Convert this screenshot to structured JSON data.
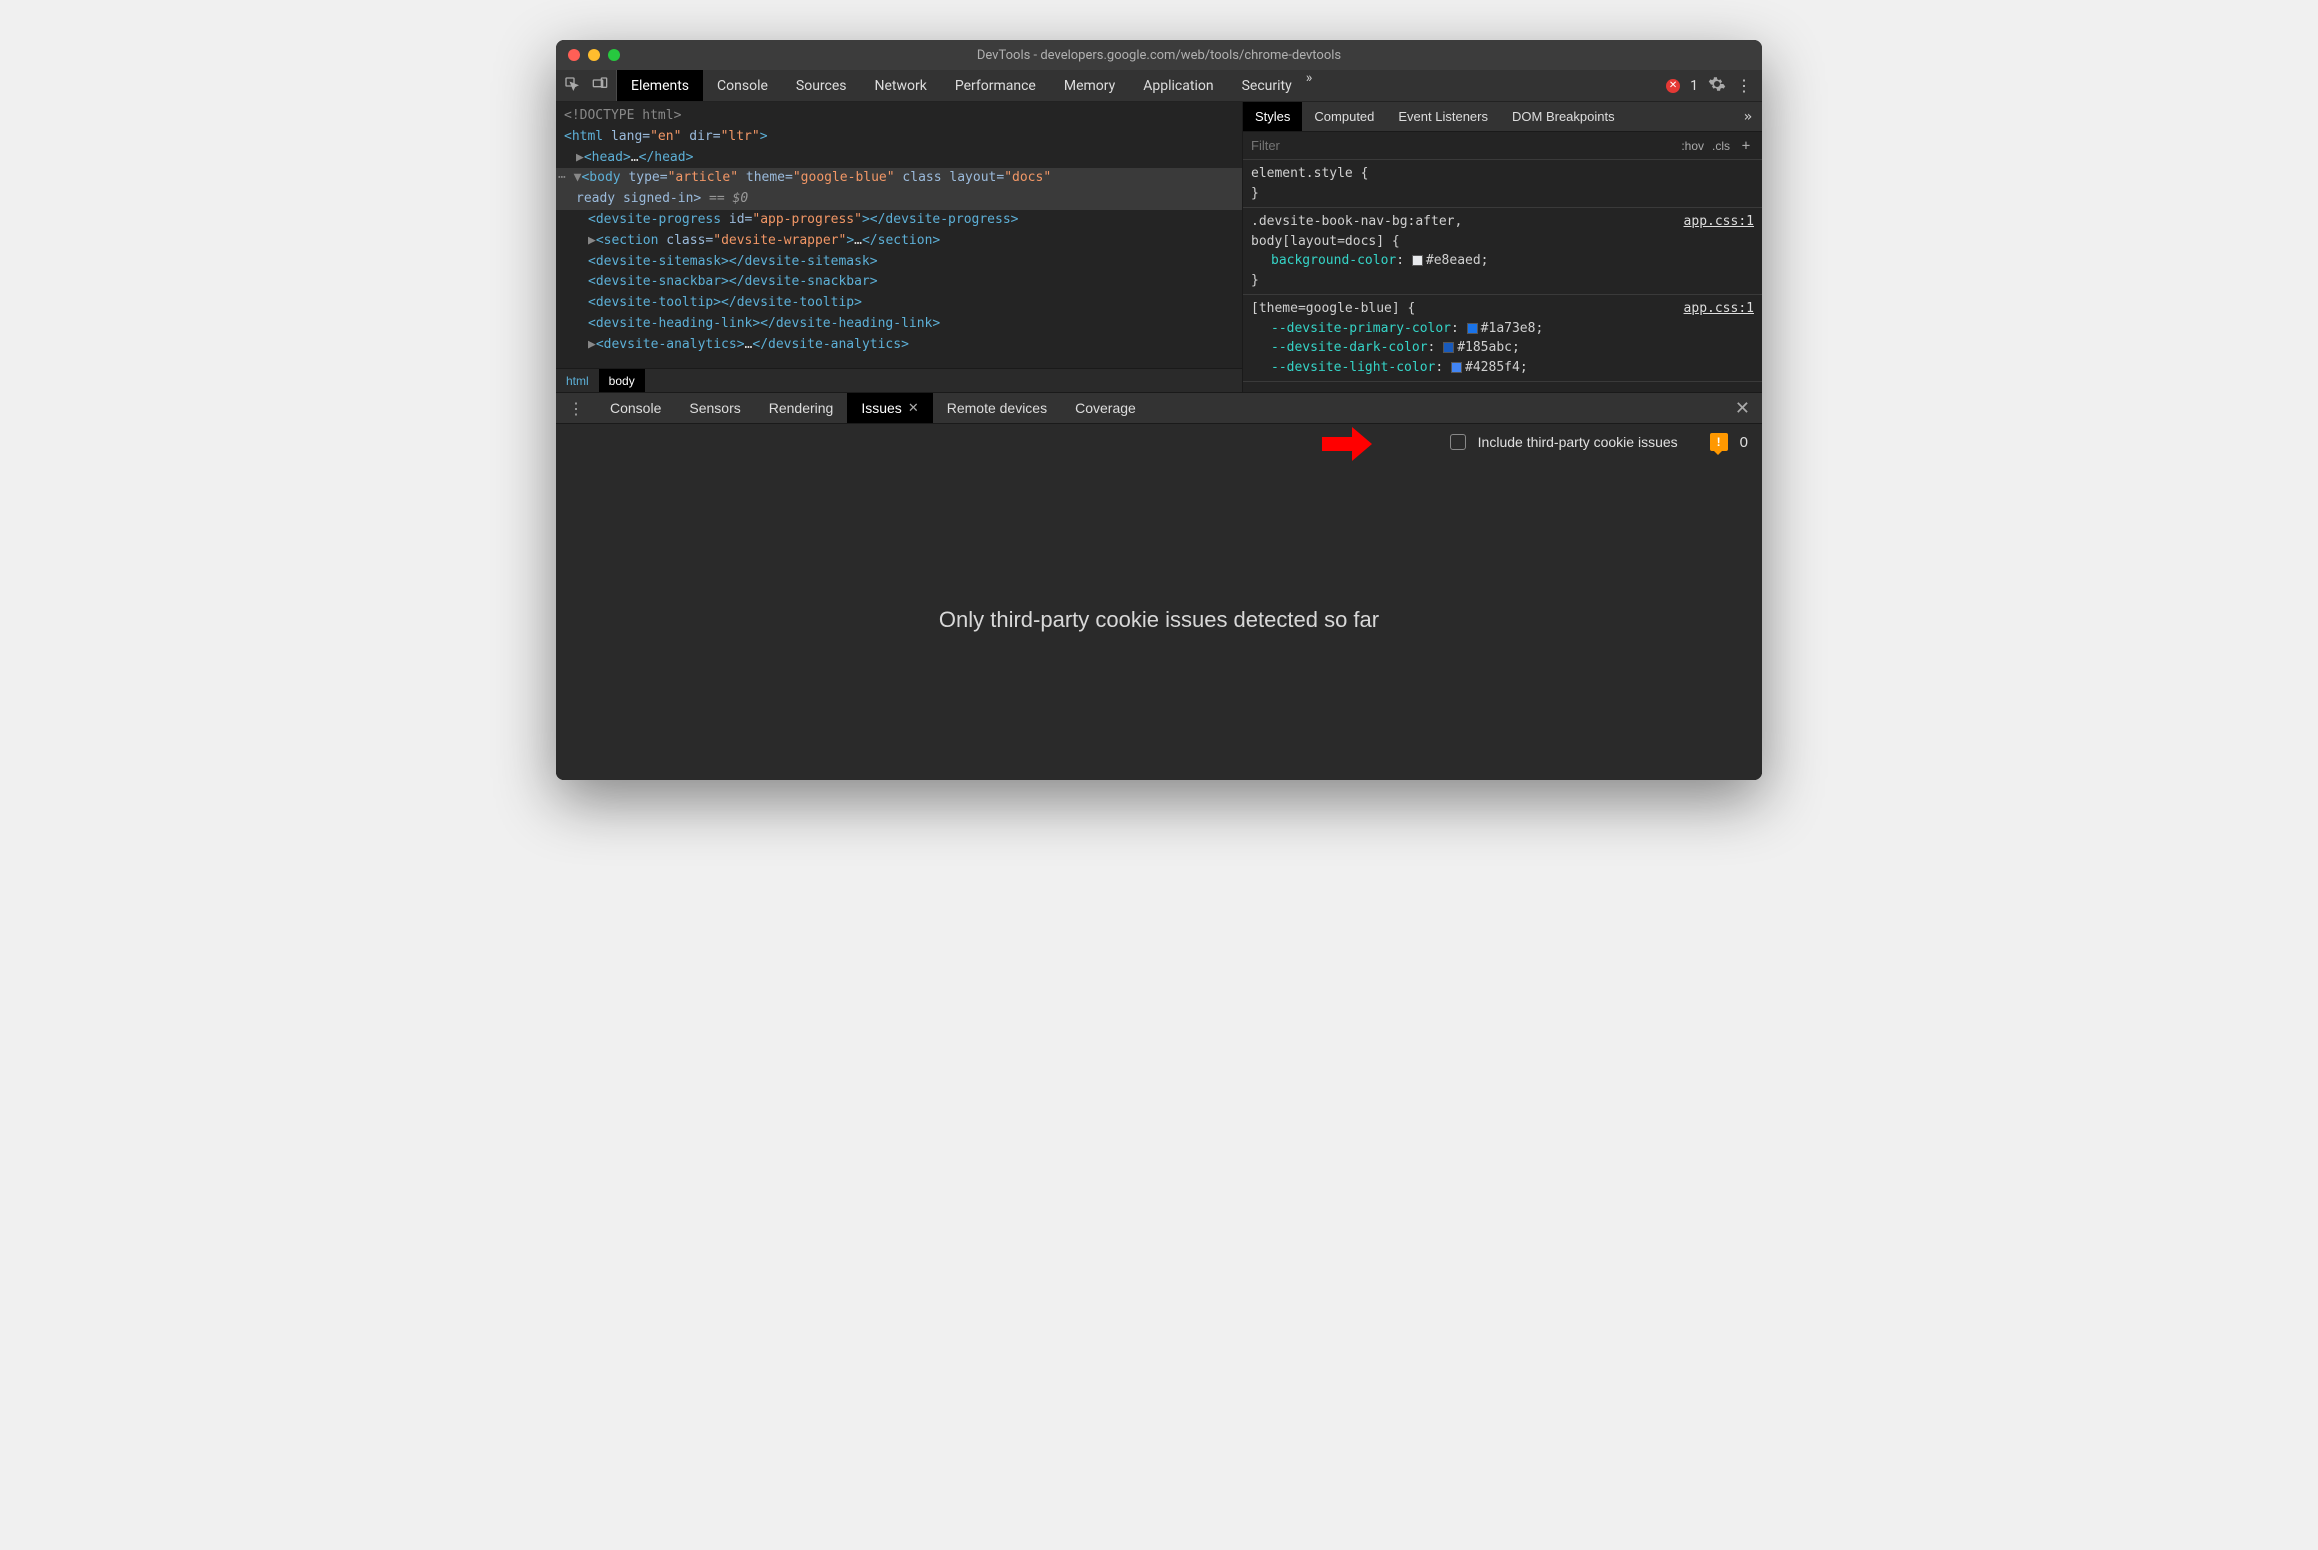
{
  "window": {
    "title": "DevTools - developers.google.com/web/tools/chrome-devtools"
  },
  "main_tabs": {
    "items": [
      "Elements",
      "Console",
      "Sources",
      "Network",
      "Performance",
      "Memory",
      "Application",
      "Security"
    ],
    "active": "Elements",
    "error_count": "1"
  },
  "dom": {
    "doctype": "<!DOCTYPE html>",
    "html_open": "<html lang=\"en\" dir=\"ltr\">",
    "head": {
      "open": "<head>",
      "ellipsis": "…",
      "close": "</head>"
    },
    "body": {
      "open_tag": "body",
      "attr_type_name": "type",
      "attr_type_val": "\"article\"",
      "attr_theme_name": "theme",
      "attr_theme_val": "\"google-blue\"",
      "attr_class_name": "class",
      "attr_layout_name": "layout",
      "attr_layout_val": "\"docs\"",
      "body_line2": "ready signed-in>",
      "eq0": " == $0"
    },
    "children": [
      {
        "text": "<devsite-progress id=\"app-progress\"></devsite-progress>"
      },
      {
        "arrow": "▶",
        "text": "<section class=\"devsite-wrapper\">…</section>"
      },
      {
        "text": "<devsite-sitemask></devsite-sitemask>"
      },
      {
        "text": "<devsite-snackbar></devsite-snackbar>"
      },
      {
        "text": "<devsite-tooltip></devsite-tooltip>"
      },
      {
        "text": "<devsite-heading-link></devsite-heading-link>"
      },
      {
        "arrow": "▶",
        "text": "<devsite-analytics>…</devsite-analytics>"
      }
    ]
  },
  "crumbs": {
    "items": [
      "html",
      "body"
    ],
    "selected": "body"
  },
  "styles": {
    "tabs": [
      "Styles",
      "Computed",
      "Event Listeners",
      "DOM Breakpoints"
    ],
    "active": "Styles",
    "filter_placeholder": "Filter",
    "hov": ":hov",
    "cls": ".cls",
    "rules": {
      "r0": {
        "selector": "element.style {",
        "close": "}"
      },
      "r1": {
        "selector1": ".devsite-book-nav-bg:after,",
        "selector2": "body[layout=docs] {",
        "source": "app.css:1",
        "prop_name": "background-color",
        "prop_val": "#e8eaed;",
        "swatch": "#e8eaed",
        "close": "}"
      },
      "r2": {
        "selector": "[theme=google-blue] {",
        "source": "app.css:1",
        "p1_name": "--devsite-primary-color",
        "p1_val": "#1a73e8;",
        "p1_swatch": "#1a73e8",
        "p2_name": "--devsite-dark-color",
        "p2_val": "#185abc;",
        "p2_swatch": "#185abc",
        "p3_name": "--devsite-light-color",
        "p3_val": "#4285f4;",
        "p3_swatch": "#4285f4"
      }
    }
  },
  "drawer": {
    "tabs": [
      "Console",
      "Sensors",
      "Rendering",
      "Issues",
      "Remote devices",
      "Coverage"
    ],
    "active": "Issues",
    "checkbox_label": "Include third-party cookie issues",
    "issue_count": "0",
    "body_text": "Only third-party cookie issues detected so far"
  }
}
